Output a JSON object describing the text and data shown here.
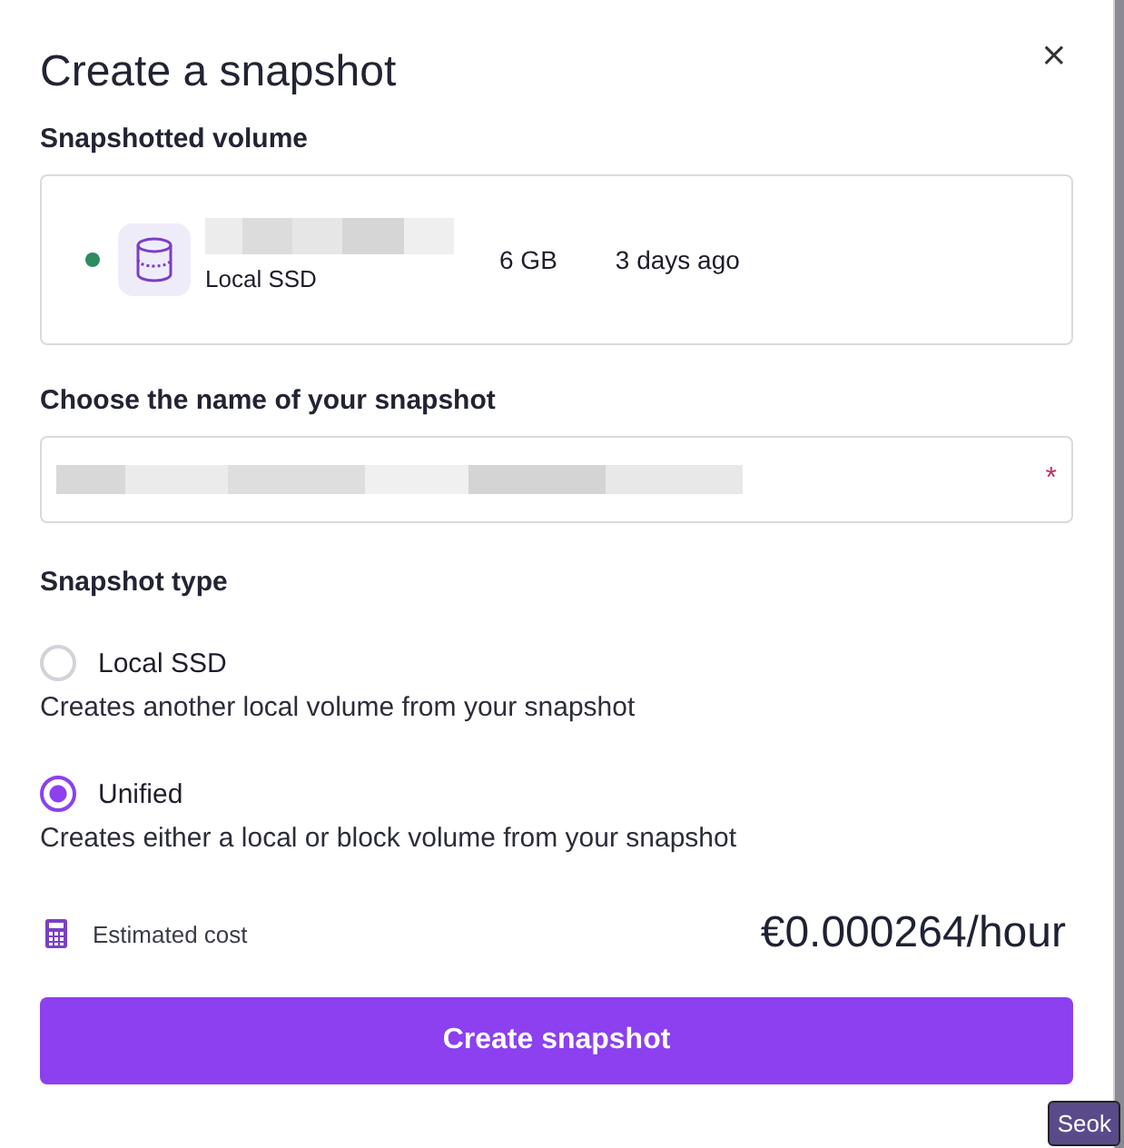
{
  "dialog": {
    "title": "Create a snapshot",
    "close": "×"
  },
  "volume_section": {
    "label": "Snapshotted volume",
    "volume": {
      "color": "#2e8b62",
      "type": "Local SSD",
      "size": "6 GB",
      "created": "3 days ago"
    }
  },
  "name_section": {
    "label": "Choose the name of your snapshot",
    "required_mark": "*"
  },
  "type_section": {
    "label": "Snapshot type",
    "options": [
      {
        "label": "Local SSD",
        "description": "Creates another local volume from your snapshot",
        "selected": false
      },
      {
        "label": "Unified",
        "description": "Creates either a local or block volume from your snapshot",
        "selected": true
      }
    ]
  },
  "cost": {
    "label": "Estimated cost",
    "value": "€0.000264/hour"
  },
  "submit_button": "Create snapshot",
  "user_badge": "Seok"
}
